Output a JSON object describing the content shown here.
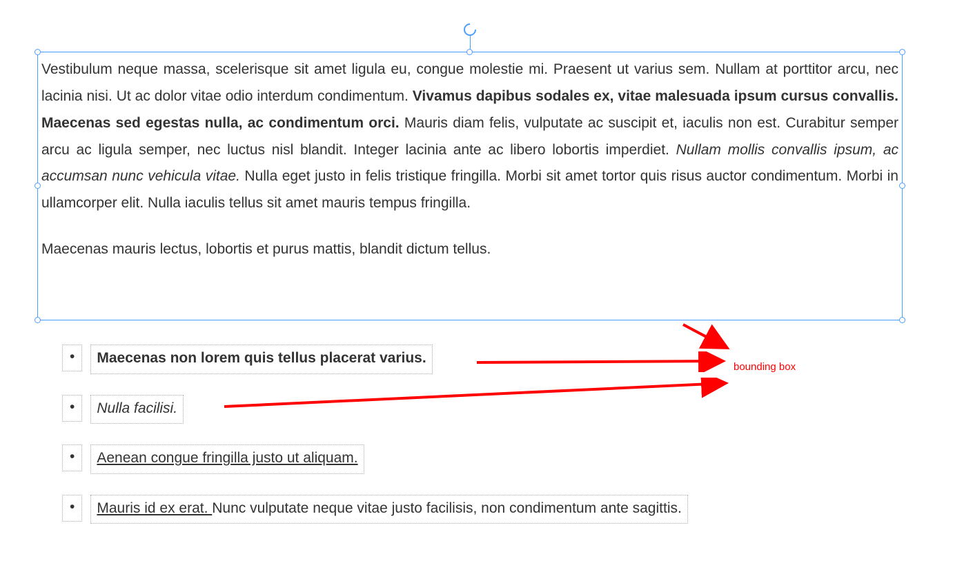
{
  "paragraph1": {
    "run1": "Vestibulum neque massa, scelerisque sit amet ligula eu, congue molestie mi. Praesent ut varius sem. Nullam at porttitor arcu, nec lacinia nisi. Ut ac dolor vitae odio interdum condimentum. ",
    "run2_bold": "Vivamus dapibus sodales ex, vitae malesuada ipsum cursus convallis. Maecenas sed egestas nulla, ac condimentum orci.",
    "run3": " Mauris diam felis, vulputate ac suscipit et, iaculis non est. Curabitur semper arcu ac ligula semper, nec luctus nisl blandit. Integer lacinia ante ac libero lobortis imperdiet. ",
    "run4_italic": "Nullam mollis convallis ipsum, ac accumsan nunc vehicula vitae.",
    "run5": " Nulla eget justo in felis tristique fringilla. Morbi sit amet tortor quis risus auctor condimentum. Morbi in ullamcorper elit. Nulla iaculis tellus sit amet mauris tempus fringilla."
  },
  "paragraph2": "Maecenas mauris lectus, lobortis et purus mattis, blandit dictum tellus.",
  "bullet_char": "•",
  "list": {
    "item1_bold": "Maecenas non lorem quis tellus placerat varius.",
    "item2_italic": "Nulla facilisi.",
    "item3_underline": "Aenean congue fringilla justo ut aliquam.",
    "item4_underline_part": "Mauris id ex erat. ",
    "item4_rest": "Nunc vulputate neque vitae justo facilisis, non condimentum ante sagittis."
  },
  "annotation": {
    "label": "bounding box"
  },
  "colors": {
    "selection": "#4a9eff",
    "annotation": "#ff0000"
  }
}
